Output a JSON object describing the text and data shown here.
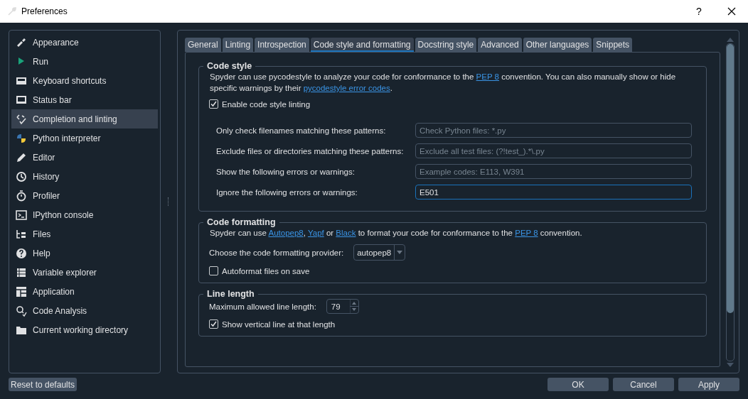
{
  "window": {
    "title": "Preferences",
    "help": "?"
  },
  "sidebar": {
    "items": [
      {
        "label": "Appearance",
        "selected": false
      },
      {
        "label": "Run",
        "selected": false
      },
      {
        "label": "Keyboard shortcuts",
        "selected": false
      },
      {
        "label": "Status bar",
        "selected": false
      },
      {
        "label": "Completion and linting",
        "selected": true
      },
      {
        "label": "Python interpreter",
        "selected": false
      },
      {
        "label": "Editor",
        "selected": false
      },
      {
        "label": "History",
        "selected": false
      },
      {
        "label": "Profiler",
        "selected": false
      },
      {
        "label": "IPython console",
        "selected": false
      },
      {
        "label": "Files",
        "selected": false
      },
      {
        "label": "Help",
        "selected": false
      },
      {
        "label": "Variable explorer",
        "selected": false
      },
      {
        "label": "Application",
        "selected": false
      },
      {
        "label": "Code Analysis",
        "selected": false
      },
      {
        "label": "Current working directory",
        "selected": false
      }
    ]
  },
  "tabs": [
    {
      "label": "General",
      "selected": false
    },
    {
      "label": "Linting",
      "selected": false
    },
    {
      "label": "Introspection",
      "selected": false
    },
    {
      "label": "Code style and formatting",
      "selected": true
    },
    {
      "label": "Docstring style",
      "selected": false
    },
    {
      "label": "Advanced",
      "selected": false
    },
    {
      "label": "Other languages",
      "selected": false
    },
    {
      "label": "Snippets",
      "selected": false
    }
  ],
  "sections": [
    {
      "title": "Code style",
      "items": [
        {
          "kind": "paragraph",
          "segments": [
            {
              "kind": "text",
              "text": "Spyder can use pycodestyle to analyze your code for conformance to the "
            },
            {
              "kind": "link",
              "text": "PEP 8"
            },
            {
              "kind": "text",
              "text": " convention. You can also manually show or hide specific warnings by their "
            },
            {
              "kind": "link",
              "text": "pycodestyle error codes"
            },
            {
              "kind": "text",
              "text": "."
            }
          ]
        },
        {
          "kind": "checkbox",
          "label": "Enable code style linting",
          "checked": true
        },
        {
          "kind": "field",
          "label": "Only check filenames matching these patterns:",
          "placeholder": "Check Python files: *.py",
          "focused": false
        },
        {
          "kind": "field",
          "label": "Exclude files or directories matching these patterns:",
          "placeholder": "Exclude all test files: (?!test_).*\\.py",
          "focused": false
        },
        {
          "kind": "field",
          "label": "Show the following errors or warnings:",
          "placeholder": "Example codes: E113, W391",
          "focused": false
        },
        {
          "kind": "field",
          "label": "Ignore the following errors or warnings:",
          "value": "E501",
          "focused": true
        }
      ]
    },
    {
      "title": "Code formatting",
      "items": [
        {
          "kind": "paragraph",
          "segments": [
            {
              "kind": "text",
              "text": "Spyder can use "
            },
            {
              "kind": "link",
              "text": "Autopep8"
            },
            {
              "kind": "text",
              "text": ", "
            },
            {
              "kind": "link",
              "text": "Yapf"
            },
            {
              "kind": "text",
              "text": " or "
            },
            {
              "kind": "link",
              "text": "Black"
            },
            {
              "kind": "text",
              "text": " to format your code for conformance to the "
            },
            {
              "kind": "link",
              "text": "PEP 8"
            },
            {
              "kind": "text",
              "text": " convention."
            }
          ]
        },
        {
          "kind": "dropdown",
          "label": "Choose the code formatting provider:",
          "value": "autopep8"
        },
        {
          "kind": "checkbox",
          "label": "Autoformat files on save",
          "checked": false
        }
      ]
    },
    {
      "title": "Line length",
      "items": [
        {
          "kind": "spinbox",
          "label": "Maximum allowed line length:",
          "value": "79"
        },
        {
          "kind": "checkbox",
          "label": "Show vertical line at that length",
          "checked": true
        }
      ]
    }
  ],
  "footer": {
    "reset": "Reset to defaults",
    "buttons": [
      "OK",
      "Cancel",
      "Apply"
    ]
  }
}
